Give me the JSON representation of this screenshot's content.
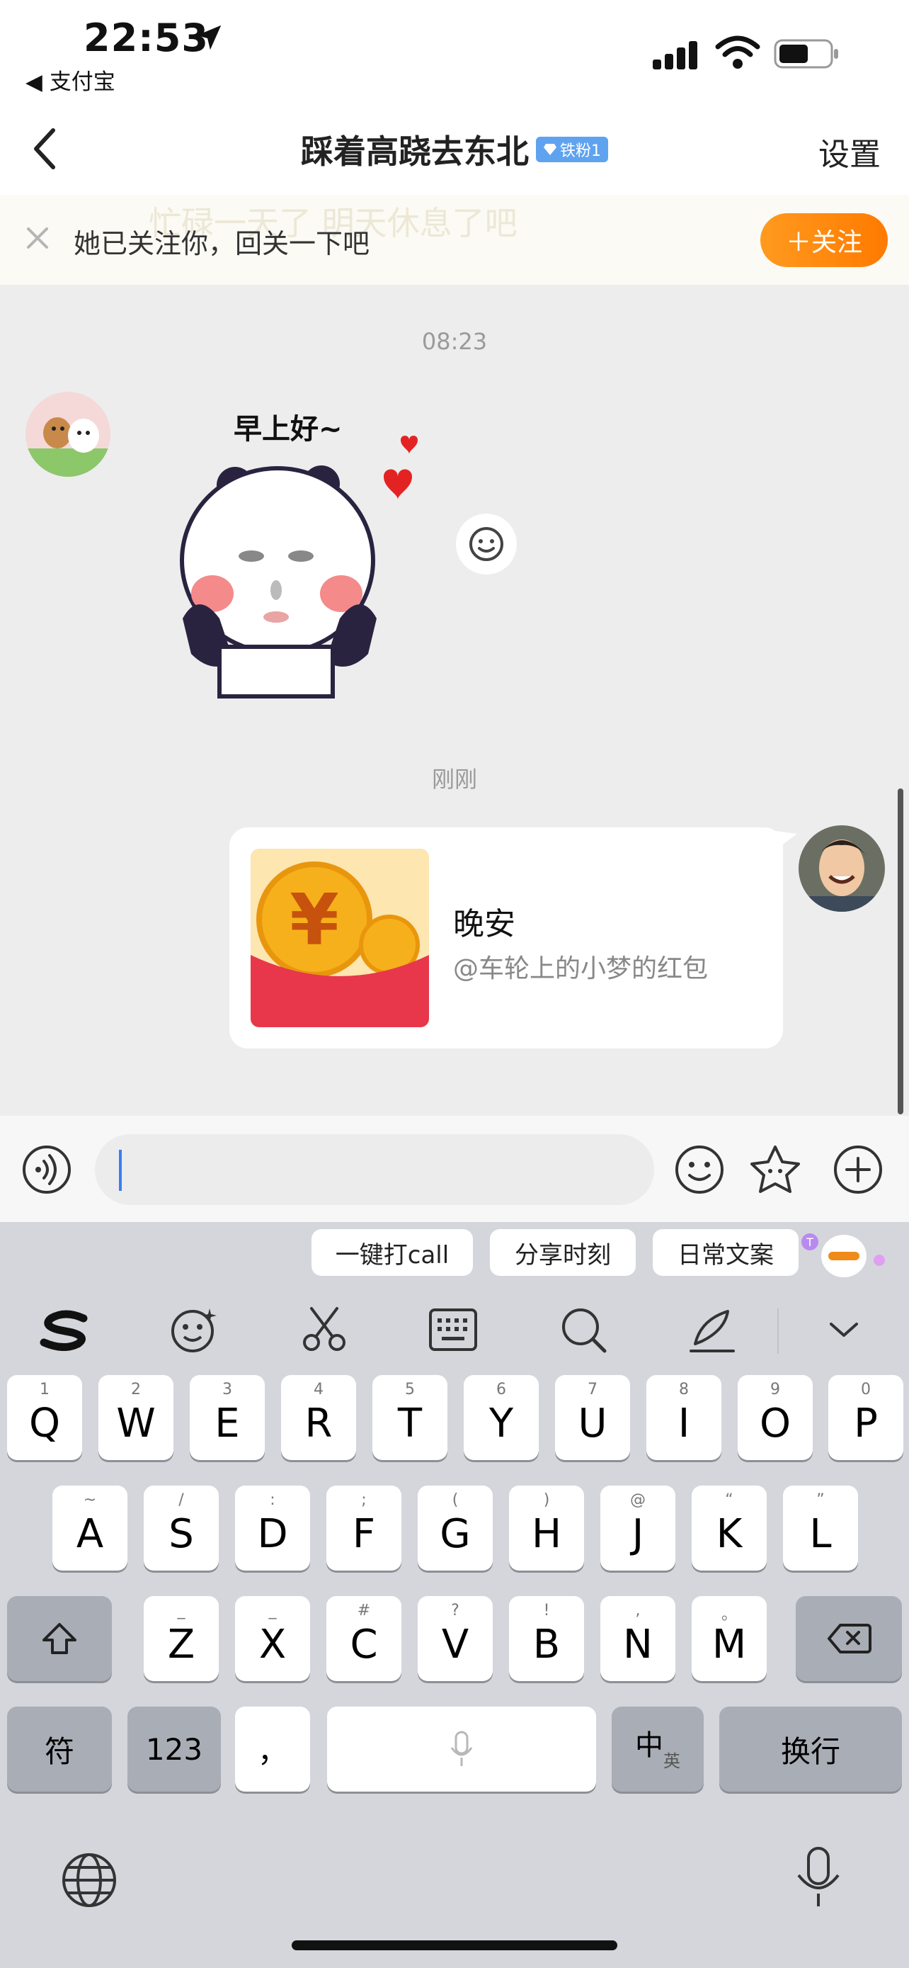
{
  "status_bar": {
    "time": "22:53",
    "back_app": "◀ 支付宝"
  },
  "nav": {
    "title": "踩着高跷去东北",
    "badge": "铁粉1",
    "settings": "设置"
  },
  "follow_banner": {
    "ghost_text": "忙碌一天了 明天休息了吧",
    "text": "她已关注你，回关一下吧",
    "follow_button": "＋关注"
  },
  "chat": {
    "timestamp_1": "08:23",
    "sticker_caption": "早上好~",
    "timestamp_2": "刚刚",
    "red_packet": {
      "title": "晚安",
      "subtitle": "@车轮上的小梦的红包"
    }
  },
  "composer": {
    "input_value": ""
  },
  "keyboard": {
    "suggestions": [
      "一键打call",
      "分享时刻",
      "日常文案"
    ],
    "row1": [
      {
        "k": "Q",
        "h": "1"
      },
      {
        "k": "W",
        "h": "2"
      },
      {
        "k": "E",
        "h": "3"
      },
      {
        "k": "R",
        "h": "4"
      },
      {
        "k": "T",
        "h": "5"
      },
      {
        "k": "Y",
        "h": "6"
      },
      {
        "k": "U",
        "h": "7"
      },
      {
        "k": "I",
        "h": "8"
      },
      {
        "k": "O",
        "h": "9"
      },
      {
        "k": "P",
        "h": "0"
      }
    ],
    "row2": [
      {
        "k": "A",
        "h": "~"
      },
      {
        "k": "S",
        "h": "/"
      },
      {
        "k": "D",
        "h": ":"
      },
      {
        "k": "F",
        "h": ";"
      },
      {
        "k": "G",
        "h": "("
      },
      {
        "k": "H",
        "h": ")"
      },
      {
        "k": "J",
        "h": "@"
      },
      {
        "k": "K",
        "h": "“"
      },
      {
        "k": "L",
        "h": "”"
      }
    ],
    "row3": [
      {
        "k": "Z",
        "h": "_"
      },
      {
        "k": "X",
        "h": "_"
      },
      {
        "k": "C",
        "h": "#"
      },
      {
        "k": "V",
        "h": "?"
      },
      {
        "k": "B",
        "h": "!"
      },
      {
        "k": "N",
        "h": ","
      },
      {
        "k": "M",
        "h": "。"
      }
    ],
    "symbols_key": "符",
    "numbers_key": "123",
    "punct_key": "，",
    "lang_key_main": "中",
    "lang_key_sub": "英",
    "return_key": "换行"
  },
  "colors": {
    "accent_orange": "#ff8a00",
    "badge_blue": "#5fa3f0",
    "red_packet_red": "#e8374a",
    "chat_bg": "#ededed"
  },
  "icons": [
    "location-arrow-icon",
    "signal-icon",
    "wifi-icon",
    "battery-icon",
    "back-chevron-icon",
    "close-icon",
    "voice-icon",
    "emoji-icon",
    "sticker-star-icon",
    "plus-icon",
    "swipe-s-icon",
    "face-icon",
    "scissors-icon",
    "keyboard-icon",
    "search-icon",
    "pen-icon",
    "chevron-down-icon",
    "shift-icon",
    "delete-icon",
    "mic-icon",
    "globe-icon"
  ]
}
